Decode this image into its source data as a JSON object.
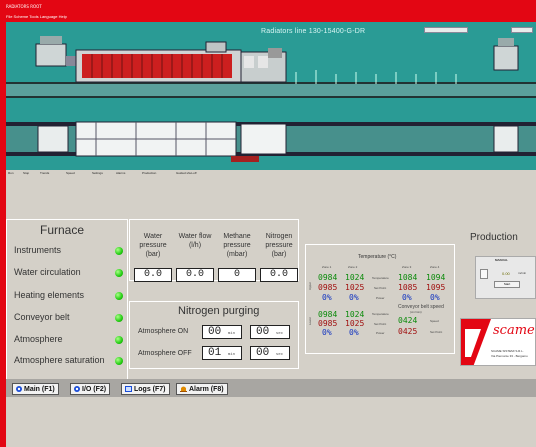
{
  "window": {
    "title": "RADIATORS ROOT",
    "menu": "File  Scheme  Tools  Language  Help"
  },
  "scene": {
    "title": "Radiators line 130-15400-G-DR",
    "chip_left": "",
    "chip_right": ""
  },
  "toolbar": {
    "items": [
      "Run",
      "Stop",
      "Trends",
      "Speed",
      "Settings",
      "Alarms",
      "Production",
      "Guided shut-off"
    ]
  },
  "furnace": {
    "title": "Furnace",
    "rows": [
      {
        "label": "Instruments",
        "status": "ok"
      },
      {
        "label": "Water circulation",
        "status": "ok"
      },
      {
        "label": "Heating elements",
        "status": "ok"
      },
      {
        "label": "Conveyor belt",
        "status": "ok"
      },
      {
        "label": "Atmosphere",
        "status": "ok"
      },
      {
        "label": "Atmosphere saturation",
        "status": "ok"
      }
    ]
  },
  "gauges": [
    {
      "label": "Water pressure (bar)",
      "value": "0.0"
    },
    {
      "label": "Water flow (l/h)",
      "value": "0.0"
    },
    {
      "label": "Methane pressure (mbar)",
      "value": "0"
    },
    {
      "label": "Nitrogen pressure (bar)",
      "value": "0.0"
    }
  ],
  "nitrogen": {
    "title": "Nitrogen purging",
    "on_label": "Atmosphere ON",
    "off_label": "Atmosphere OFF",
    "on_value_1": "00",
    "on_unit_1": "min",
    "on_value_2": "00",
    "on_unit_2": "sec",
    "off_value_1": "01",
    "off_unit_1": "min",
    "off_value_2": "00",
    "off_unit_2": "sec"
  },
  "temperature": {
    "title": "Temperature (°C)",
    "upper_label": "Upper",
    "lower_label": "Lower",
    "zone_headers": [
      "Zone 1",
      "Zone 2",
      "Zone 3",
      "Zone 4"
    ],
    "upper": {
      "actual": [
        "0984",
        "1024",
        "1084",
        "1094"
      ],
      "setpoint": [
        "0985",
        "1025",
        "1085",
        "1095"
      ],
      "power": [
        "0%",
        "0%",
        "0%",
        "0%"
      ]
    },
    "lower": {
      "actual": [
        "0984",
        "1024"
      ],
      "setpoint": [
        "0985",
        "1025"
      ],
      "power": [
        "0%",
        "0%"
      ]
    },
    "row_labels": [
      "Temperature",
      "Set Point",
      "Power"
    ],
    "belt_title": "Conveyor belt speed",
    "belt_unit": "(cm/min)",
    "belt_actual": "0424",
    "belt_setpoint": "0425",
    "belt_labels": [
      "Speed",
      "Set Point"
    ]
  },
  "production": {
    "title": "Production",
    "panel_title": "MANUAL",
    "value": "0.00",
    "unit": "m/min",
    "button": "Start"
  },
  "logo": {
    "brand": "scame",
    "line1": "SCAME SISTEMI S.R.L.",
    "line2": "Via Piemonte 33 - Bergamo"
  },
  "tabs": [
    {
      "label": "Main (F1)",
      "icon": "main-icon"
    },
    {
      "label": "I/O (F2)",
      "icon": "io-icon"
    },
    {
      "label": "Logs (F7)",
      "icon": "logs-icon"
    },
    {
      "label": "Alarm (F8)",
      "icon": "alarm-icon"
    }
  ],
  "colors": {
    "frame": "#e30613",
    "scene": "#2a9b95",
    "panel": "#d4d0c8",
    "led": "#22cc11",
    "accent_red": "#a01010"
  }
}
